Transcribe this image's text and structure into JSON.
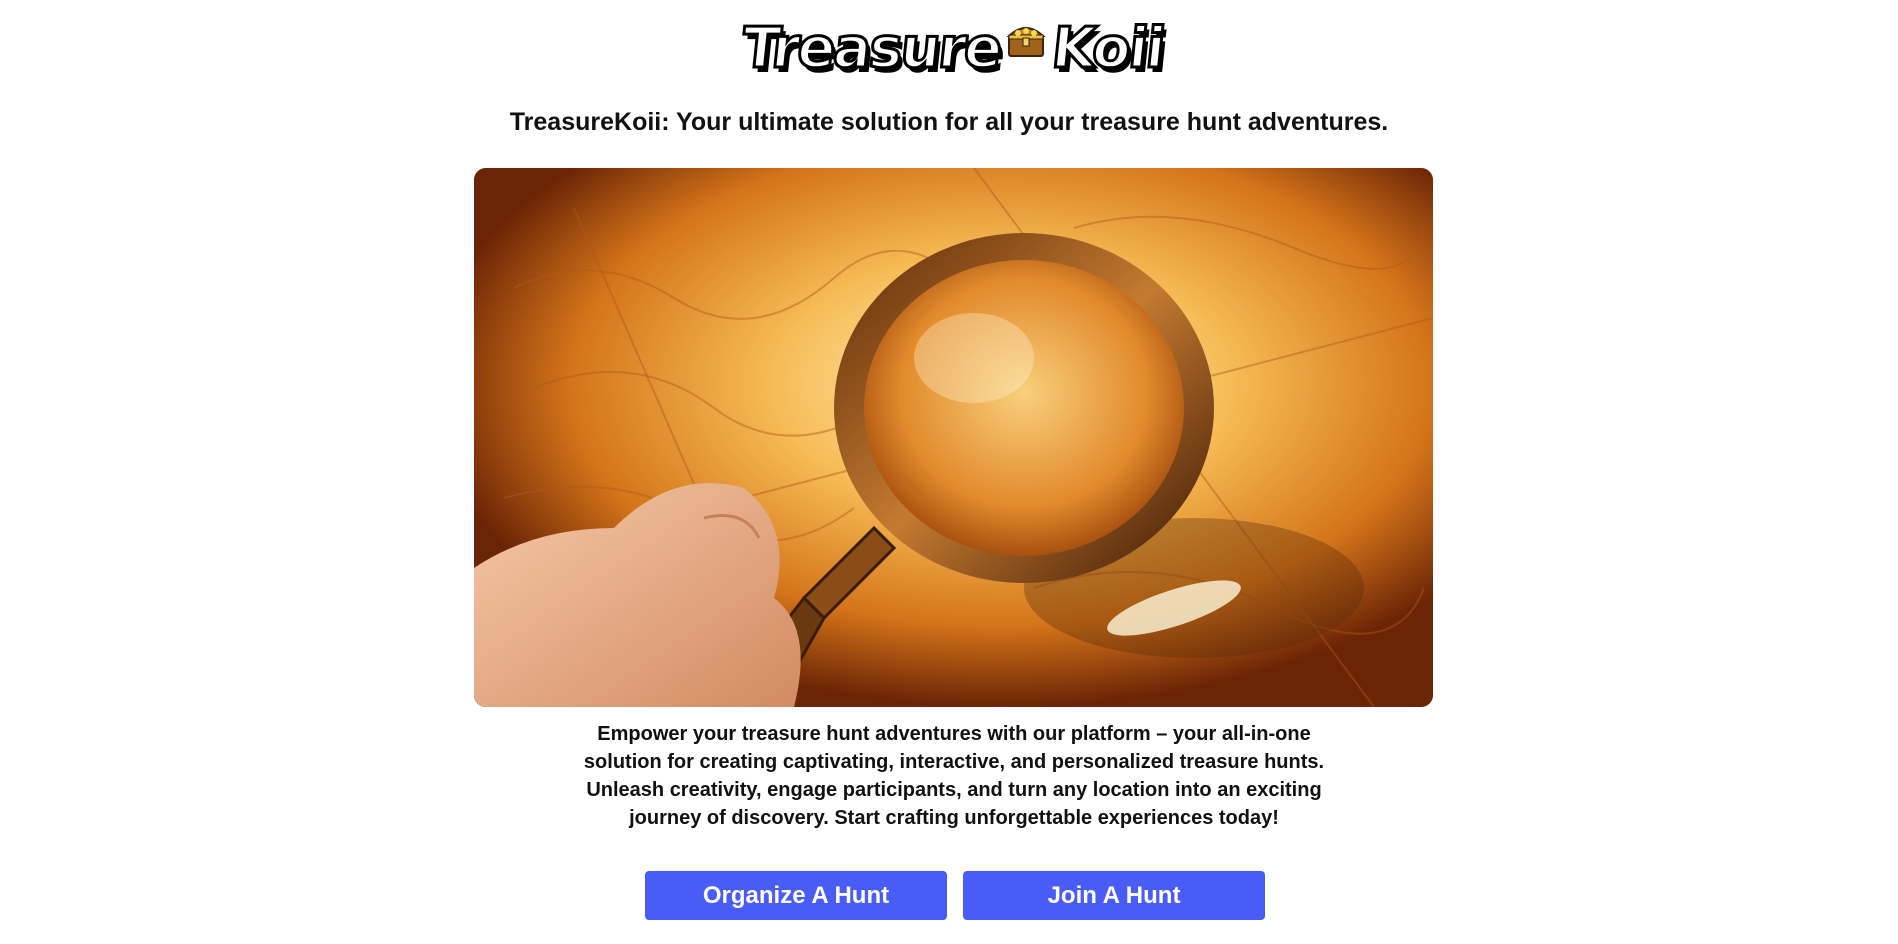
{
  "brand": {
    "logo_left": "Treasure",
    "logo_right": "Koii",
    "logo_icon": "treasure-chest-icon"
  },
  "hero": {
    "tagline": "TreasureKoii: Your ultimate solution for all your treasure hunt adventures.",
    "image_description_icon": "magnifying-glass-on-map",
    "description": "Empower your treasure hunt adventures with our platform – your all-in-one solution for creating captivating, interactive, and personalized treasure hunts. Unleash creativity, engage participants, and turn any location into an exciting journey of discovery. Start crafting unforgettable experiences today!"
  },
  "actions": {
    "organize_label": "Organize A Hunt",
    "join_label": "Join A Hunt"
  },
  "colors": {
    "button_bg": "#4a5cf7",
    "button_text": "#ffffff",
    "text": "#111111",
    "background": "#ffffff"
  }
}
